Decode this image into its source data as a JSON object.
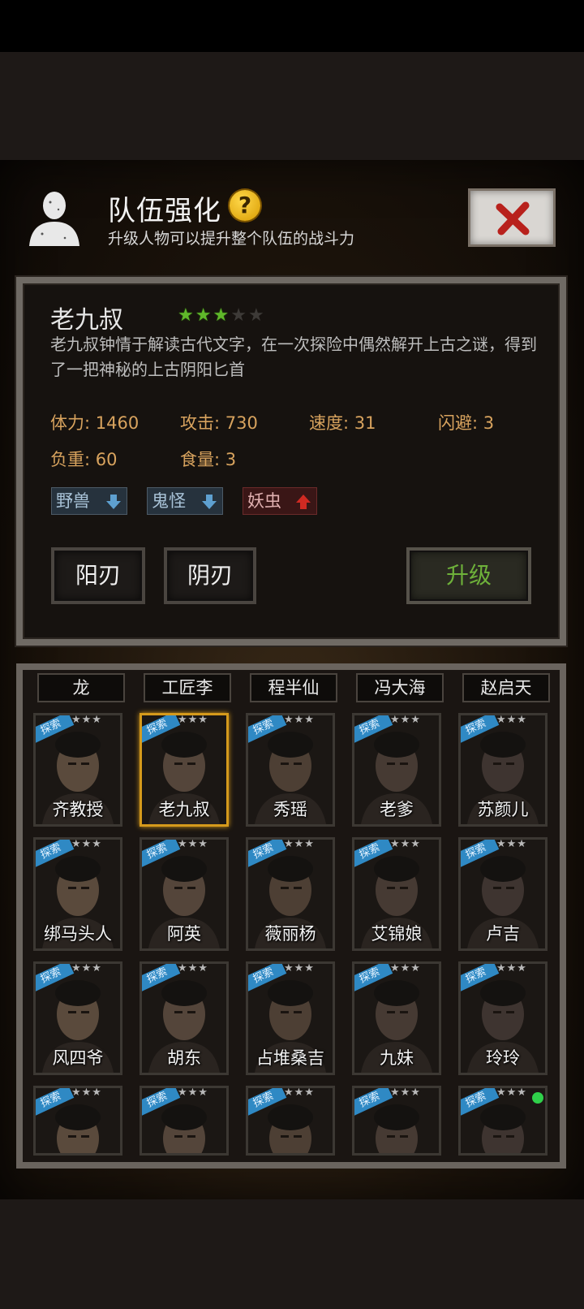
{
  "header": {
    "title": "队伍强化",
    "subtitle": "升级人物可以提升整个队伍的战斗力",
    "help_label": "?"
  },
  "hero": {
    "name": "老九叔",
    "stars_total": 5,
    "stars_filled": 3,
    "description": "老九叔钟情于解读古代文字，在一次探险中偶然解开上古之谜，得到了一把神秘的上古阴阳匕首",
    "stats": [
      {
        "label": "体力: 1460"
      },
      {
        "label": "攻击: 730"
      },
      {
        "label": "速度: 31"
      },
      {
        "label": "闪避: 3"
      },
      {
        "label": "负重: 60"
      },
      {
        "label": "食量: 3"
      }
    ],
    "tags": [
      {
        "label": "野兽",
        "direction": "down"
      },
      {
        "label": "鬼怪",
        "direction": "down"
      },
      {
        "label": "妖虫",
        "direction": "up"
      }
    ]
  },
  "buttons": {
    "yang_blade": "阳刃",
    "yin_blade": "阴刃",
    "upgrade": "升级"
  },
  "roster": {
    "top_names": [
      "龙",
      "工匠李",
      "程半仙",
      "冯大海",
      "赵启天"
    ],
    "badge": "探索",
    "cards": [
      {
        "name": "齐教授"
      },
      {
        "name": "老九叔",
        "selected": true
      },
      {
        "name": "秀瑶"
      },
      {
        "name": "老爹"
      },
      {
        "name": "苏颜儿"
      },
      {
        "name": "绑马头人"
      },
      {
        "name": "阿英"
      },
      {
        "name": "薇丽杨"
      },
      {
        "name": "艾锦娘"
      },
      {
        "name": "卢吉"
      },
      {
        "name": "风四爷"
      },
      {
        "name": "胡东"
      },
      {
        "name": "占堆桑吉"
      },
      {
        "name": "九妹"
      },
      {
        "name": "玲玲"
      },
      {
        "name": ""
      },
      {
        "name": ""
      },
      {
        "name": ""
      },
      {
        "name": ""
      },
      {
        "name": ""
      }
    ]
  },
  "colors": {
    "accent_green": "#6eb13a",
    "stat_orange": "#d8a35e",
    "selected_border": "#d59a1c",
    "badge_blue": "#2f89c4"
  }
}
